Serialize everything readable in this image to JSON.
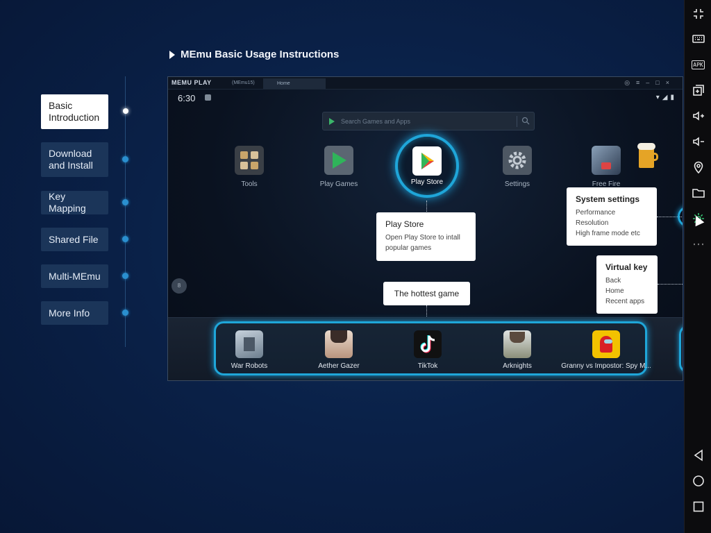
{
  "heading": "MEmu Basic Usage Instructions",
  "nav": [
    {
      "label_line1": "Basic",
      "label_line2": "Introduction",
      "active": true
    },
    {
      "label_line1": "Download",
      "label_line2": "and Install",
      "active": false
    },
    {
      "label_line1": "Key Mapping",
      "label_line2": "",
      "active": false
    },
    {
      "label_line1": "Shared File",
      "label_line2": "",
      "active": false
    },
    {
      "label_line1": "Multi-MEmu",
      "label_line2": "",
      "active": false
    },
    {
      "label_line1": "More Info",
      "label_line2": "",
      "active": false
    }
  ],
  "preview": {
    "logo": "MEMU PLAY",
    "instance": "(MEmu15)",
    "tab": "Home",
    "time": "6:30",
    "search_placeholder": "Search Games and Apps",
    "apps": [
      {
        "label": "Tools",
        "icon": "tools-icon"
      },
      {
        "label": "Play Games",
        "icon": "play-games-icon"
      },
      {
        "label": "Play Store",
        "icon": "play-store-icon"
      },
      {
        "label": "Settings",
        "icon": "settings-icon"
      },
      {
        "label": "Free Fire",
        "icon": "free-fire-icon"
      }
    ],
    "tips": {
      "play_store": {
        "title": "Play Store",
        "line1": "Open Play Store to intall",
        "line2": "popular games"
      },
      "system_settings": {
        "title": "System settings",
        "items": [
          "Performance",
          "Resolution",
          "High frame mode etc"
        ]
      },
      "virtual_key": {
        "title": "Virtual key",
        "items": [
          "Back",
          "Home",
          "Recent apps"
        ]
      },
      "hottest": {
        "title": "The hottest game"
      }
    },
    "hot_games": [
      {
        "label": "War Robots",
        "icon": "war-robots-icon"
      },
      {
        "label": "Aether Gazer",
        "icon": "aether-gazer-icon"
      },
      {
        "label": "TikTok",
        "icon": "tiktok-icon"
      },
      {
        "label": "Arknights",
        "icon": "arknights-icon"
      },
      {
        "label": "Granny vs Impostor: Spy M...",
        "icon": "granny-vs-impostor-icon"
      }
    ]
  },
  "toolbar": {
    "apk_label": "APK",
    "icons": [
      "collapse-icon",
      "keyboard-icon",
      "apk-icon",
      "multi-window-icon",
      "volume-up-icon",
      "volume-down-icon",
      "location-icon",
      "folder-icon",
      "settings-gear-icon",
      "more-icon",
      "back-icon",
      "home-icon",
      "recent-apps-icon"
    ]
  },
  "colors": {
    "accent": "#1fa6d9",
    "nav_bg": "#1b3559",
    "background": "#0a2148"
  }
}
